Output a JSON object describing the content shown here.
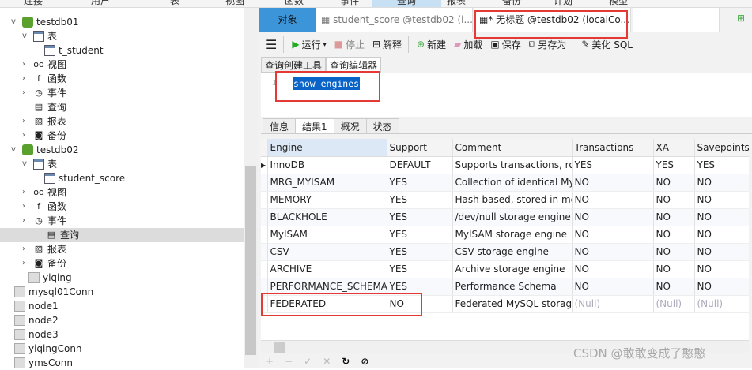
{
  "menu": [
    "连接",
    "用户",
    "表",
    "视图",
    "函数",
    "事件",
    "查询",
    "报表",
    "备份",
    "计划",
    "模型"
  ],
  "menu_active": "查询",
  "sidebar": {
    "items": [
      {
        "label": "testdb01",
        "icon": "database-icon"
      },
      {
        "label": "表",
        "icon": "table-icon"
      },
      {
        "label": "t_student",
        "icon": "table-icon"
      },
      {
        "label": "视图",
        "icon": "view-icon"
      },
      {
        "label": "函数",
        "icon": "function-icon"
      },
      {
        "label": "事件",
        "icon": "event-icon"
      },
      {
        "label": "查询",
        "icon": "query-icon"
      },
      {
        "label": "报表",
        "icon": "report-icon"
      },
      {
        "label": "备份",
        "icon": "backup-icon"
      },
      {
        "label": "testdb02",
        "icon": "database-icon"
      },
      {
        "label": "表",
        "icon": "table-icon"
      },
      {
        "label": "student_score",
        "icon": "table-icon"
      },
      {
        "label": "视图",
        "icon": "view-icon"
      },
      {
        "label": "函数",
        "icon": "function-icon"
      },
      {
        "label": "事件",
        "icon": "event-icon"
      },
      {
        "label": "查询",
        "icon": "query-icon"
      },
      {
        "label": "报表",
        "icon": "report-icon"
      },
      {
        "label": "备份",
        "icon": "backup-icon"
      },
      {
        "label": "yiqing",
        "icon": "database-icon"
      },
      {
        "label": "mysql01Conn",
        "icon": "connection-icon"
      },
      {
        "label": "node1",
        "icon": "connection-icon"
      },
      {
        "label": "node2",
        "icon": "connection-icon"
      },
      {
        "label": "node3",
        "icon": "connection-icon"
      },
      {
        "label": "yiqingConn",
        "icon": "connection-icon"
      },
      {
        "label": "ymsConn",
        "icon": "connection-icon"
      }
    ]
  },
  "tabs": {
    "objects": "对象",
    "tab1": "student_score @testdb02 (l...",
    "tab2": "* 无标题 @testdb02 (localCo..."
  },
  "toolbar": {
    "run": "运行",
    "stop": "停止",
    "explain": "解释",
    "new": "新建",
    "load": "加载",
    "save": "保存",
    "save_as": "另存为",
    "beautify": "美化 SQL"
  },
  "subtabs": {
    "builder": "查询创建工具",
    "editor": "查询编辑器"
  },
  "editor": {
    "line": "1",
    "code": "show engines"
  },
  "result_tabs": [
    "信息",
    "结果1",
    "概况",
    "状态"
  ],
  "table": {
    "columns": [
      "Engine",
      "Support",
      "Comment",
      "Transactions",
      "XA",
      "Savepoints"
    ],
    "rows": [
      [
        "InnoDB",
        "DEFAULT",
        "Supports transactions, row-level locking",
        "YES",
        "YES",
        "YES"
      ],
      [
        "MRG_MYISAM",
        "YES",
        "Collection of identical MyISAM tables",
        "NO",
        "NO",
        "NO"
      ],
      [
        "MEMORY",
        "YES",
        "Hash based, stored in memory",
        "NO",
        "NO",
        "NO"
      ],
      [
        "BLACKHOLE",
        "YES",
        "/dev/null storage engine",
        "NO",
        "NO",
        "NO"
      ],
      [
        "MyISAM",
        "YES",
        "MyISAM storage engine",
        "NO",
        "NO",
        "NO"
      ],
      [
        "CSV",
        "YES",
        "CSV storage engine",
        "NO",
        "NO",
        "NO"
      ],
      [
        "ARCHIVE",
        "YES",
        "Archive storage engine",
        "NO",
        "NO",
        "NO"
      ],
      [
        "PERFORMANCE_SCHEMA",
        "YES",
        "Performance Schema",
        "NO",
        "NO",
        "NO"
      ],
      [
        "FEDERATED",
        "NO",
        "Federated MySQL storage engine",
        "(Null)",
        "(Null)",
        "(Null)"
      ]
    ]
  },
  "watermark": "CSDN @敢敢变成了憨憨"
}
